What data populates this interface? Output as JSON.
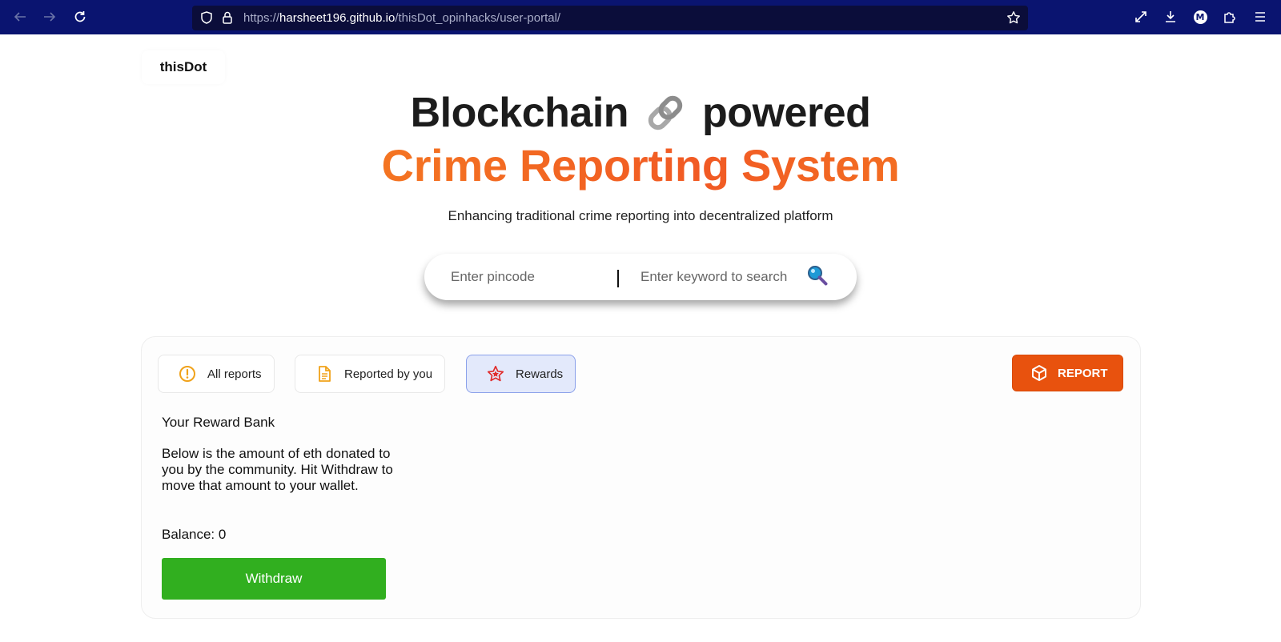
{
  "browser": {
    "url_prefix": "https://",
    "url_host": "harsheet196.github.io",
    "url_path": "/thisDot_opinhacks/user-portal/",
    "profile_initial": "M",
    "icons": [
      "back-icon",
      "forward-icon",
      "reload-icon",
      "shield-icon",
      "lock-icon",
      "star-icon",
      "fullscreen-icon",
      "download-icon",
      "extensions-icon",
      "menu-icon"
    ]
  },
  "page": {
    "logo": "thisDot",
    "hero": {
      "line1_before": "Blockchain",
      "line1_after": "powered",
      "line2": "Crime Reporting System",
      "subtitle": "Enhancing traditional crime reporting into decentralized platform"
    },
    "search": {
      "pincode_placeholder": "Enter pincode",
      "keyword_placeholder": "Enter keyword to search",
      "pincode_value": "",
      "keyword_value": ""
    },
    "tabs": [
      {
        "label": "All reports",
        "icon": "alert-icon",
        "active": false
      },
      {
        "label": "Reported by you",
        "icon": "document-icon",
        "active": false
      },
      {
        "label": "Rewards",
        "icon": "stars-icon",
        "active": true
      }
    ],
    "report_button": "REPORT",
    "rewards": {
      "title": "Your Reward Bank",
      "description": "Below is the amount of eth donated to you by the community. Hit Withdraw to move that amount to your wallet.",
      "balance": "Balance: 0",
      "withdraw_label": "Withdraw"
    }
  },
  "colors": {
    "chrome_bg": "#0a1470",
    "accent_orange": "#f15a24",
    "report_button": "#e8520e",
    "withdraw_green": "#31af1f",
    "active_tab_bg": "#e3e9fb"
  }
}
